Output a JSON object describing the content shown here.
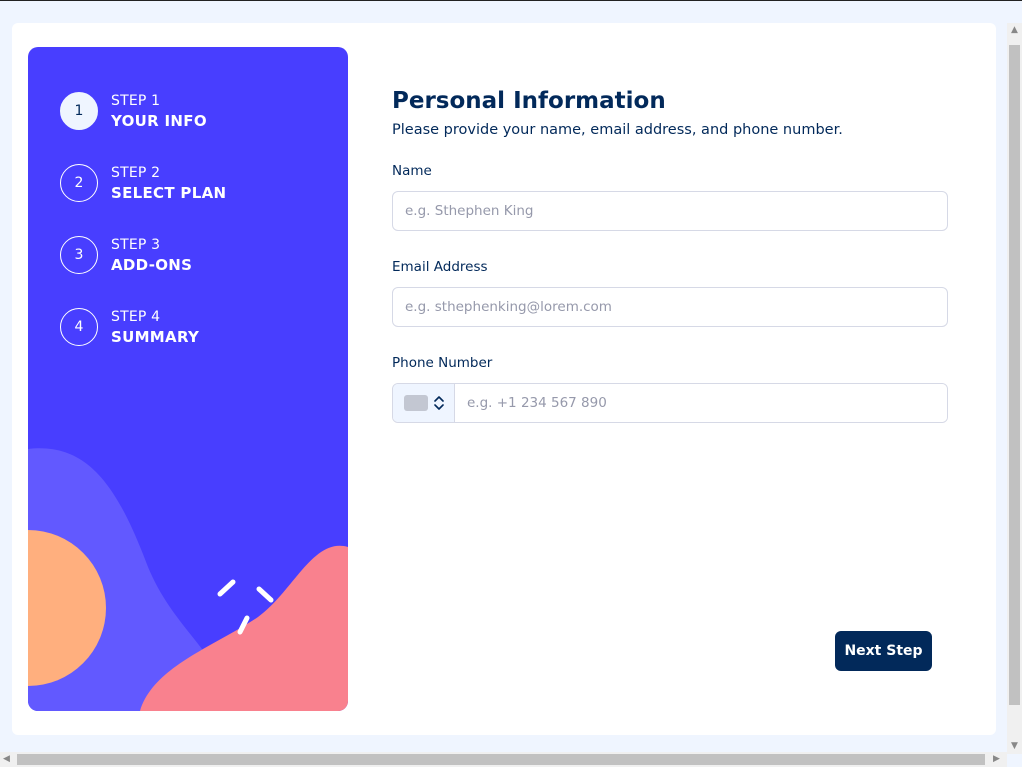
{
  "sidebar": {
    "steps": [
      {
        "number": "1",
        "small": "STEP 1",
        "big": "YOUR INFO",
        "active": true
      },
      {
        "number": "2",
        "small": "STEP 2",
        "big": "SELECT PLAN",
        "active": false
      },
      {
        "number": "3",
        "small": "STEP 3",
        "big": "ADD-ONS",
        "active": false
      },
      {
        "number": "4",
        "small": "STEP 4",
        "big": "SUMMARY",
        "active": false
      }
    ]
  },
  "form": {
    "title": "Personal Information",
    "subtitle": "Please provide your name, email address, and phone number.",
    "name": {
      "label": "Name",
      "placeholder": "e.g. Sthephen King",
      "value": ""
    },
    "email": {
      "label": "Email Address",
      "placeholder": "e.g. sthephenking@lorem.com",
      "value": ""
    },
    "phone": {
      "label": "Phone Number",
      "placeholder": "e.g. +1 234 567 890",
      "value": "",
      "country_icon": "flag-placeholder-icon"
    },
    "next_label": "Next Step"
  },
  "colors": {
    "sidebar_bg": "#483eff",
    "primary_text": "#02295a",
    "accent_orange": "#ffaf7e",
    "accent_pink": "#f9818e",
    "accent_violet": "#6259ff"
  }
}
